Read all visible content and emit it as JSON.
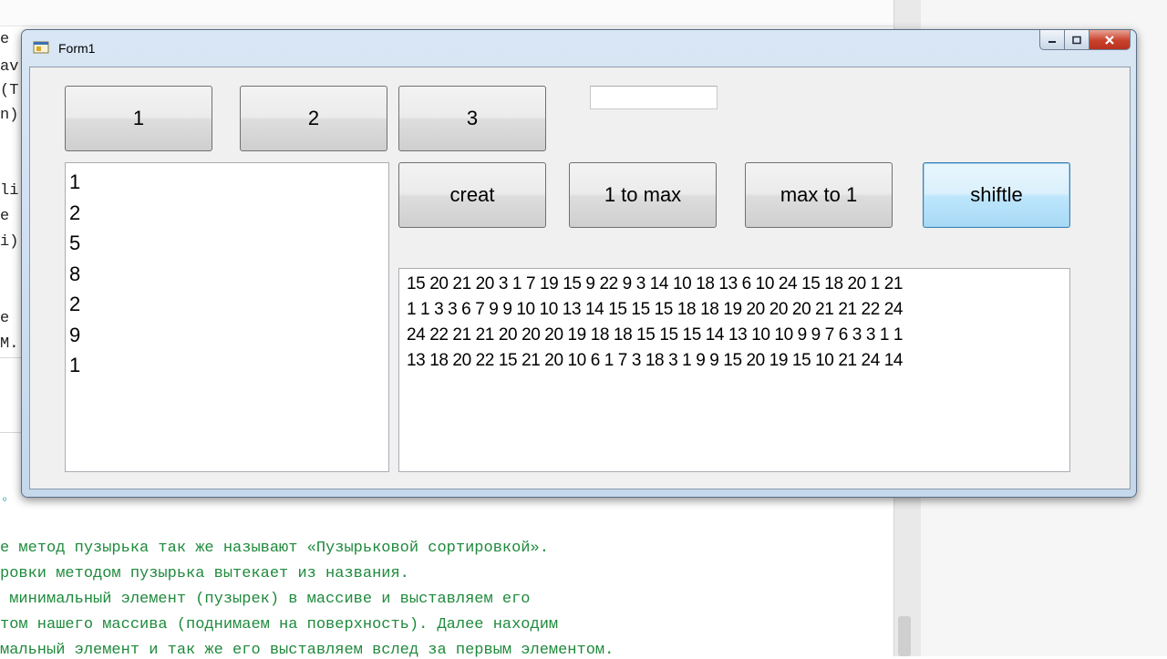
{
  "editor": {
    "code_fragments": [
      "e",
      "av",
      "(T",
      "n)",
      "li",
      "e",
      "i)",
      "e",
      "M."
    ],
    "comment_lines": [
      "е метод пузырька так же называют «Пузырьковой сортировкой».",
      "ровки методом пузырька вытекает из названия.",
      " минимальный элемент (пузырек) в массиве и выставляем его",
      "том нашего массива (поднимаем на поверхность). Далее находим",
      "мальный элемент и так же его выставляем вслед за первым элементом."
    ]
  },
  "window": {
    "title": "Form1",
    "icon": "form-app-icon"
  },
  "buttons": {
    "b1": "1",
    "b2": "2",
    "b3": "3",
    "creat": "creat",
    "to_max": "1 to max",
    "max_to_1": "max to 1",
    "shuffle": "shiftle"
  },
  "textbox_value": "",
  "listbox_items": [
    "1",
    "2",
    "5",
    "8",
    "2",
    "9",
    "1"
  ],
  "output_lines": [
    "15 20 21 20 3 1 7 19 15 9 22 9 3 14 10 18 13 6 10 24 15 18 20 1 21",
    "1 1 3 3 6 7 9 9 10 10 13 14 15 15 15 18 18 19 20 20 20 21 21 22 24",
    "24 22 21 21 20 20 20 19 18 18 15 15 15 14 13 10 10 9 9 7 6 3 3 1 1",
    "13 18 20 22 15 21 20 10 6 1 7 3 18 3 1 9 9 15 20 19 15 10 21 24 14"
  ],
  "colors": {
    "comment": "#1f8a3c",
    "close_button": "#c9412b",
    "window_frame": "#c5d8ec"
  }
}
